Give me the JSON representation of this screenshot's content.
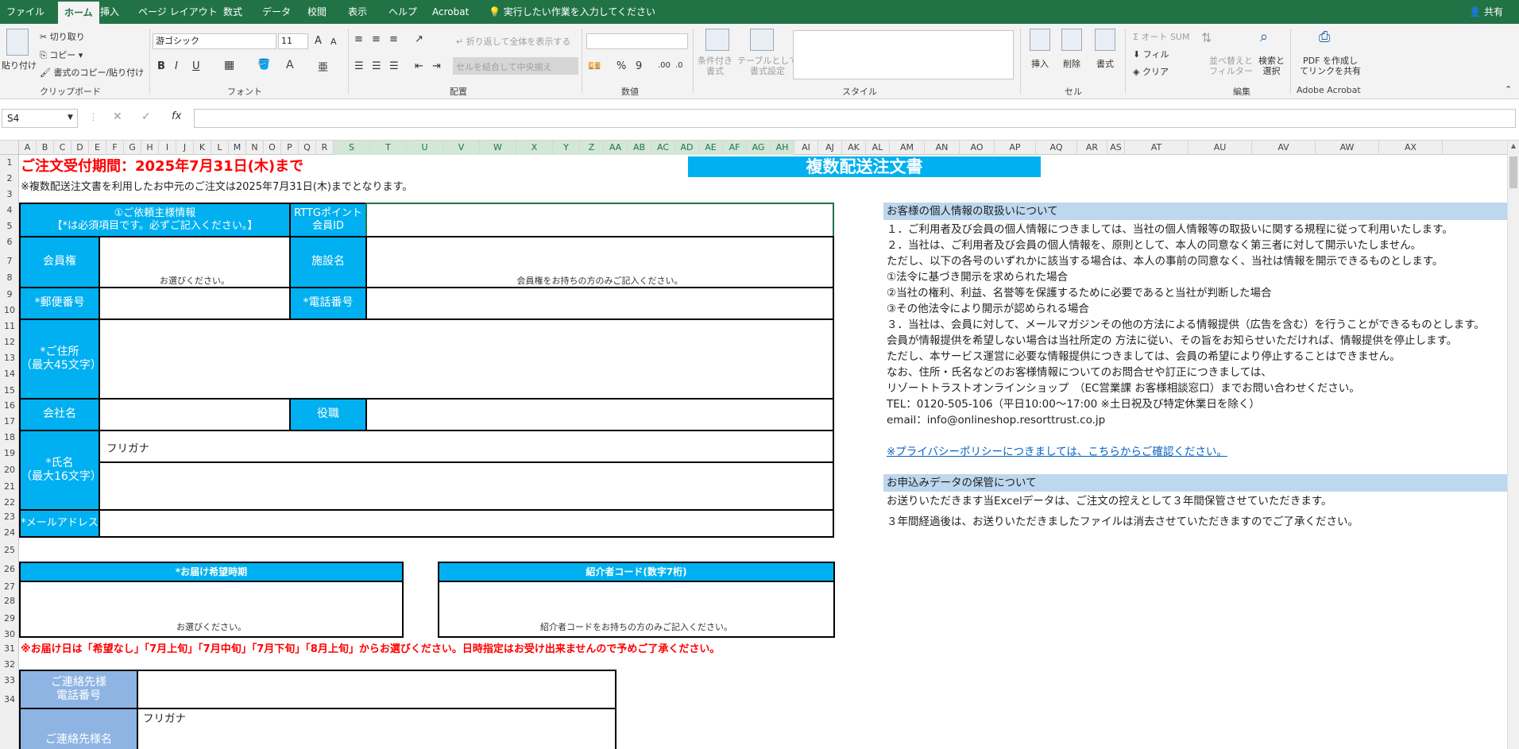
{
  "tabs": [
    "ファイル",
    "ホーム",
    "挿入",
    "ページ レイアウト",
    "数式",
    "データ",
    "校閲",
    "表示",
    "ヘルプ",
    "Acrobat"
  ],
  "tell_me": "実行したい作業を入力してください",
  "share": "共有",
  "ribbon": {
    "clipboard": {
      "paste": "貼り付け",
      "cut": "切り取り",
      "copy": "コピー",
      "format_painter": "書式のコピー/貼り付け",
      "label": "クリップボード"
    },
    "font": {
      "name": "游ゴシック",
      "size": "11",
      "bold": "B",
      "italic": "I",
      "underline": "U",
      "label": "フォント"
    },
    "alignment": {
      "wrap": "折り返して全体を表示する",
      "merge": "セルを結合して中央揃え",
      "label": "配置"
    },
    "number": {
      "percent": "%",
      "comma": "9",
      "label": "数値"
    },
    "styles": {
      "conditional": "条件付き\n書式",
      "table": "テーブルとして\n書式設定",
      "label": "スタイル"
    },
    "cells": {
      "insert": "挿入",
      "delete": "削除",
      "format": "書式",
      "label": "セル"
    },
    "editing": {
      "autosum": "オート SUM",
      "fill": "フィル",
      "clear": "クリア",
      "sort": "並べ替えと\nフィルター",
      "find": "検索と\n選択",
      "label": "編集"
    },
    "acrobat": {
      "create": "PDF を作成し\nてリンクを共有",
      "label": "Adobe Acrobat"
    }
  },
  "namebox": "S4",
  "fx": "fx",
  "columns": [
    "A",
    "B",
    "C",
    "D",
    "E",
    "F",
    "G",
    "H",
    "I",
    "J",
    "K",
    "L",
    "M",
    "N",
    "O",
    "P",
    "Q",
    "R",
    "S",
    "T",
    "U",
    "V",
    "W",
    "X",
    "Y",
    "Z",
    "AA",
    "AB",
    "AC",
    "AD",
    "AE",
    "AF",
    "AG",
    "AH",
    "AI",
    "AJ",
    "AK",
    "AL",
    "AM",
    "AN",
    "AO",
    "AP",
    "AQ",
    "AR",
    "AS",
    "AT",
    "AU",
    "AV",
    "AW",
    "AX"
  ],
  "rows": [
    "1",
    "2",
    "3",
    "4",
    "5",
    "6",
    "7",
    "8",
    "9",
    "10",
    "11",
    "12",
    "13",
    "14",
    "15",
    "16",
    "17",
    "18",
    "19",
    "20",
    "21",
    "22",
    "23",
    "24",
    "25",
    "26",
    "27",
    "28",
    "29",
    "30",
    "31",
    "32",
    "33",
    "34"
  ],
  "sheet": {
    "deadline": "ご注文受付期間：2025年7月31日(木)まで",
    "title": "複数配送注文書",
    "note": "※複数配送注文書を利用したお中元のご注文は2025年7月31日(木)までとなります。",
    "requester": "①ご依頼主様情報\n【*は必須項目です。必ずご記入ください。】",
    "rttg": "RTTGポイント\n会員ID",
    "membership": "会員権",
    "please_select": "お選びください。",
    "facility": "施設名",
    "facility_hint": "会員権をお持ちの方のみご記入ください。",
    "postal": "*郵便番号",
    "phone": "*電話番号",
    "address": "*ご住所\n（最大45文字）",
    "company": "会社名",
    "position": "役職",
    "name": "*氏名\n（最大16文字）",
    "furigana": "フリガナ",
    "email": "*メールアドレス",
    "delivery_period": "*お届け希望時期",
    "delivery_hint": "お選びください。",
    "referrer": "紹介者コード(数字7桁)",
    "referrer_hint": "紹介者コードをお持ちの方のみご記入ください。",
    "delivery_note": "※お届け日は「希望なし」「7月上旬」「7月中旬」「7月下旬」「8月上旬」からお選びください。日時指定はお受け出来ませんので予めご了承ください。",
    "contact_phone": "ご連絡先様\n電話番号",
    "contact_name": "ご連絡先様名",
    "contact_furigana": "フリガナ"
  },
  "privacy": {
    "heading": "お客様の個人情報の取扱いについて",
    "lines": [
      "１．ご利用者及び会員の個人情報につきましては、当社の個人情報等の取扱いに関する規程に従って利用いたします。",
      "２．当社は、ご利用者及び会員の個人情報を、原則として、本人の同意なく第三者に対して開示いたしません。",
      "ただし、以下の各号のいずれかに該当する場合は、本人の事前の同意なく、当社は情報を開示できるものとします。",
      "①法令に基づき開示を求められた場合",
      "②当社の権利、利益、名誉等を保護するために必要であると当社が判断した場合",
      "③その他法令により開示が認められる場合",
      "３．当社は、会員に対して、メールマガジンその他の方法による情報提供（広告を含む）を行うことができるものとします。",
      "会員が情報提供を希望しない場合は当社所定の 方法に従い、その旨をお知らせいただければ、情報提供を停止します。",
      "ただし、本サービス運営に必要な情報提供につきましては、会員の希望により停止することはできません。",
      "なお、住所・氏名などのお客様情報についてのお問合せや訂正につきましては、",
      "リゾートトラストオンラインショップ　（EC営業課 お客様相談窓口）までお問い合わせください。",
      "TEL：0120-505-106（平日10:00～17:00 ※土日祝及び特定休業日を除く）",
      "email：info@onlineshop.resorttrust.co.jp"
    ],
    "link": "※プライバシーポリシーにつきましては、こちらからご確認ください。",
    "storage_heading": "お申込みデータの保管について",
    "storage_lines": [
      "お送りいただきます当Excelデータは、ご注文の控えとして３年間保管させていただきます。",
      "３年間経過後は、お送りいただきましたファイルは消去させていただきますのでご了承ください。"
    ]
  },
  "colors": {
    "excel_green": "#217346",
    "cyan": "#00b0f0",
    "red": "#ff0000",
    "light_blue": "#bdd7ee",
    "contact_blue": "#8eb4e3",
    "link": "#0563c1"
  }
}
